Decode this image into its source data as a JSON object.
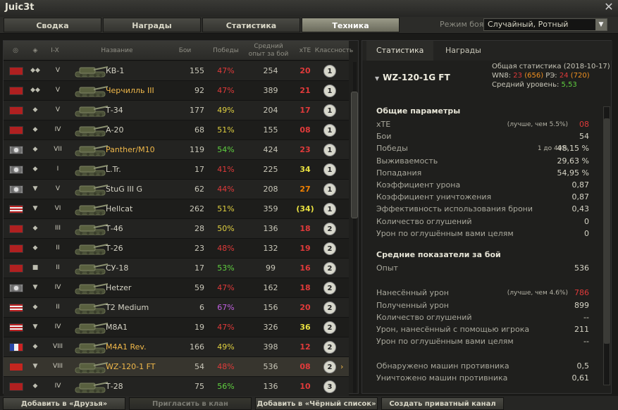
{
  "window": {
    "title": "Juic3t",
    "close_icon": "close-icon"
  },
  "tabs": [
    {
      "label": "Сводка",
      "active": false
    },
    {
      "label": "Награды",
      "active": false
    },
    {
      "label": "Статистика",
      "active": false
    },
    {
      "label": "Техника",
      "active": true
    }
  ],
  "mode": {
    "label": "Режим боя:",
    "value": "Случайный, Ротный"
  },
  "table": {
    "headers": {
      "nation_icon": "globe-icon",
      "type_icon": "tank-type-icon",
      "tier": "I-X",
      "name": "Название",
      "battles": "Бои",
      "wins": "Победы",
      "avg_xp": "Средний опыт за бой",
      "xte": "xTE",
      "class": "Классность"
    },
    "rows": [
      {
        "nation": "ussr",
        "type": "◆◆",
        "tier": "V",
        "name": "КВ-1",
        "premium": false,
        "battles": "155",
        "wins": "47%",
        "wins_color": "bad",
        "xp": "254",
        "xte": "20",
        "xte_color": "bad",
        "badge": "1"
      },
      {
        "nation": "ussr",
        "type": "◆◆",
        "tier": "V",
        "name": "Черчилль III",
        "premium": true,
        "battles": "92",
        "wins": "47%",
        "wins_color": "bad",
        "xp": "389",
        "xte": "21",
        "xte_color": "bad",
        "badge": "1"
      },
      {
        "nation": "ussr",
        "type": "◆",
        "tier": "V",
        "name": "Т-34",
        "premium": false,
        "battles": "177",
        "wins": "49%",
        "wins_color": "mid",
        "xp": "204",
        "xte": "17",
        "xte_color": "bad",
        "badge": "1"
      },
      {
        "nation": "ussr",
        "type": "◆",
        "tier": "IV",
        "name": "А-20",
        "premium": false,
        "battles": "68",
        "wins": "51%",
        "wins_color": "mid",
        "xp": "155",
        "xte": "08",
        "xte_color": "bad",
        "badge": "1"
      },
      {
        "nation": "ger",
        "type": "◆",
        "tier": "VII",
        "name": "Panther/M10",
        "premium": true,
        "battles": "119",
        "wins": "54%",
        "wins_color": "good",
        "xp": "424",
        "xte": "23",
        "xte_color": "bad",
        "badge": "1"
      },
      {
        "nation": "ger",
        "type": "◆",
        "tier": "I",
        "name": "L.Tr.",
        "premium": false,
        "battles": "17",
        "wins": "41%",
        "wins_color": "bad",
        "xp": "225",
        "xte": "34",
        "xte_color": "ylw",
        "badge": "1"
      },
      {
        "nation": "ger",
        "type": "▼",
        "tier": "V",
        "name": "StuG III G",
        "premium": false,
        "battles": "62",
        "wins": "44%",
        "wins_color": "bad",
        "xp": "208",
        "xte": "27",
        "xte_color": "orange",
        "badge": "1"
      },
      {
        "nation": "usa",
        "type": "▼",
        "tier": "VI",
        "name": "Hellcat",
        "premium": false,
        "battles": "262",
        "wins": "51%",
        "wins_color": "mid",
        "xp": "359",
        "xte": "(34)",
        "xte_color": "ylw",
        "badge": "1"
      },
      {
        "nation": "ussr",
        "type": "◆",
        "tier": "III",
        "name": "Т-46",
        "premium": false,
        "battles": "28",
        "wins": "50%",
        "wins_color": "mid",
        "xp": "136",
        "xte": "18",
        "xte_color": "bad",
        "badge": "2"
      },
      {
        "nation": "ussr",
        "type": "◆",
        "tier": "II",
        "name": "Т-26",
        "premium": false,
        "battles": "23",
        "wins": "48%",
        "wins_color": "bad",
        "xp": "132",
        "xte": "19",
        "xte_color": "bad",
        "badge": "2"
      },
      {
        "nation": "ussr",
        "type": "■",
        "tier": "II",
        "name": "СУ-18",
        "premium": false,
        "battles": "17",
        "wins": "53%",
        "wins_color": "good",
        "xp": "99",
        "xte": "16",
        "xte_color": "bad",
        "badge": "2"
      },
      {
        "nation": "ger",
        "type": "▼",
        "tier": "IV",
        "name": "Hetzer",
        "premium": false,
        "battles": "59",
        "wins": "47%",
        "wins_color": "bad",
        "xp": "162",
        "xte": "18",
        "xte_color": "bad",
        "badge": "2"
      },
      {
        "nation": "usa",
        "type": "◆",
        "tier": "II",
        "name": "T2 Medium",
        "premium": false,
        "battles": "6",
        "wins": "67%",
        "wins_color": "purple",
        "xp": "156",
        "xte": "20",
        "xte_color": "bad",
        "badge": "2"
      },
      {
        "nation": "usa",
        "type": "▼",
        "tier": "IV",
        "name": "M8A1",
        "premium": false,
        "battles": "19",
        "wins": "47%",
        "wins_color": "bad",
        "xp": "326",
        "xte": "36",
        "xte_color": "ylw",
        "badge": "2"
      },
      {
        "nation": "fr",
        "type": "◆",
        "tier": "VIII",
        "name": "M4A1 Rev.",
        "premium": true,
        "battles": "166",
        "wins": "49%",
        "wins_color": "mid",
        "xp": "398",
        "xte": "12",
        "xte_color": "bad",
        "badge": "2"
      },
      {
        "nation": "chn",
        "type": "▼",
        "tier": "VIII",
        "name": "WZ-120-1 FT",
        "premium": true,
        "battles": "54",
        "wins": "48%",
        "wins_color": "bad",
        "xp": "536",
        "xte": "08",
        "xte_color": "bad",
        "badge": "2",
        "selected": true
      },
      {
        "nation": "ussr",
        "type": "◆",
        "tier": "IV",
        "name": "Т-28",
        "premium": false,
        "battles": "75",
        "wins": "56%",
        "wins_color": "good",
        "xp": "136",
        "xte": "10",
        "xte_color": "bad",
        "badge": "3"
      }
    ]
  },
  "right": {
    "tabs": [
      "Статистика",
      "Награды"
    ],
    "vehicle": "WZ-120-1G FT",
    "general_stats": "Общая статистика (2018-10-17)",
    "wn8_label": "WN8:",
    "wn8_value": "23",
    "wn8_paren": "(656)",
    "rz_label": "РЭ:",
    "rz_value": "24",
    "rz_paren": "(720)",
    "avg_level_label": "Средний уровень:",
    "avg_level_value": "5,53",
    "section_general": "Общие параметры",
    "general": [
      {
        "label": "xTE",
        "hint": "(лучше, чем 5.5%)",
        "value": "08",
        "color": "bad"
      },
      {
        "label": "Бои",
        "value": "54"
      },
      {
        "label": "Победы",
        "hint": "1 до 49%",
        "value": "48,15 %"
      },
      {
        "label": "Выживаемость",
        "value": "29,63 %"
      },
      {
        "label": "Попадания",
        "value": "54,95 %"
      },
      {
        "label": "Коэффициент урона",
        "value": "0,87"
      },
      {
        "label": "Коэффициент уничтожения",
        "value": "0,87"
      },
      {
        "label": "Эффективность использования брони",
        "value": "0,43"
      },
      {
        "label": "Количество оглушений",
        "value": "0"
      },
      {
        "label": "Урон по оглушённым вами целям",
        "value": "0"
      }
    ],
    "section_avg": "Средние показатели за бой",
    "avg": [
      {
        "label": "Опыт",
        "value": "536"
      },
      {
        "label": "Нанесённый урон",
        "hint": "(лучше, чем 4.6%)",
        "value": "786",
        "color": "bad"
      },
      {
        "label": "Полученный урон",
        "value": "899"
      },
      {
        "label": "Количество оглушений",
        "value": "--"
      },
      {
        "label": "Урон, нанесённый с помощью игрока",
        "value": "211"
      },
      {
        "label": "Урон по оглушённым вами целям",
        "value": "--"
      },
      {
        "label": "Обнаружено машин противника",
        "value": "0,5"
      },
      {
        "label": "Уничтожено машин противника",
        "value": "0,61"
      }
    ]
  },
  "bottom": [
    {
      "label": "Добавить в «Друзья»",
      "disabled": false
    },
    {
      "label": "Пригласить в клан",
      "disabled": true
    },
    {
      "label": "Добавить в «Чёрный список»",
      "disabled": false
    },
    {
      "label": "Создать приватный канал",
      "disabled": false
    }
  ],
  "colors": {
    "bad": "#e03a3a",
    "mid": "#e0d040",
    "good": "#60d040",
    "purple": "#c060e0",
    "orange": "#f08000",
    "premium": "#f0b84a"
  }
}
